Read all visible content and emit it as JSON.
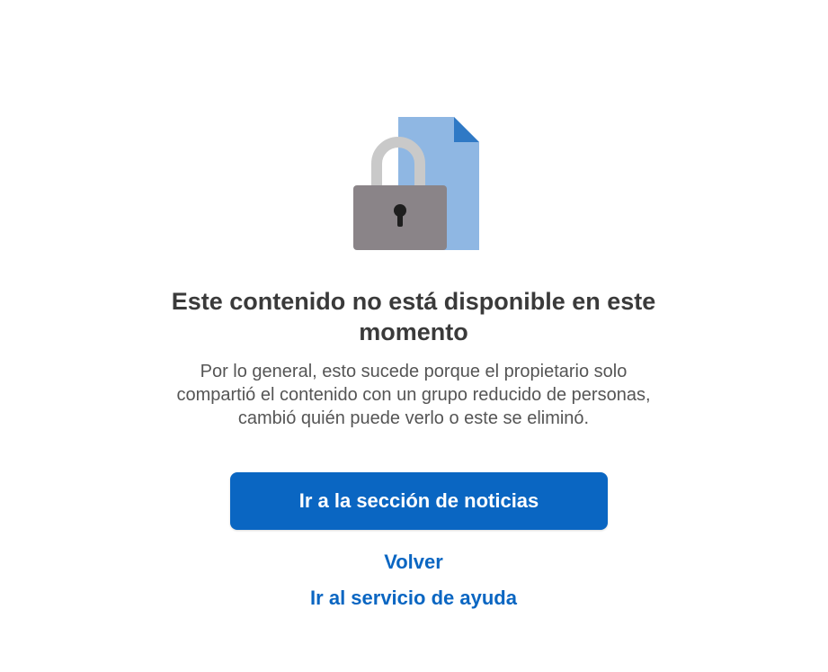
{
  "colors": {
    "accent": "#0a66c2",
    "title": "#3a3a3a",
    "body_text": "#555555",
    "lock_body": "#8a8488",
    "lock_shackle": "#c9c9c9",
    "document": "#8fb7e3",
    "document_fold": "#2f79c5"
  },
  "illustration": {
    "icon": "locked-document-icon"
  },
  "message": {
    "title_line1": "Este contenido no está disponible en este",
    "title_line2": "momento",
    "desc_line1": "Por lo general, esto sucede porque el propietario solo",
    "desc_line2": "compartió el contenido con un grupo reducido de personas,",
    "desc_line3": "cambió quién puede verlo o este se eliminó."
  },
  "actions": {
    "primary_label": "Ir a la sección de noticias",
    "back_label": "Volver",
    "help_label": "Ir al servicio de ayuda"
  }
}
